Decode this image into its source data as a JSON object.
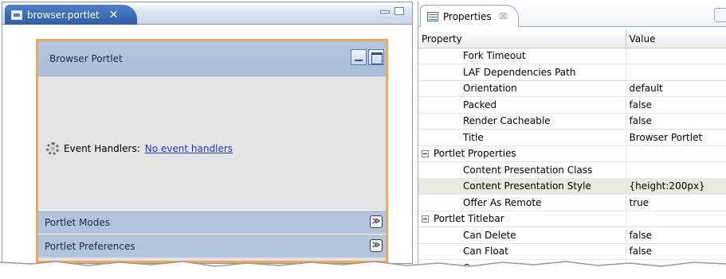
{
  "editor": {
    "tab_label": "browser.portlet",
    "close_glyph": "✕"
  },
  "portlet": {
    "title": "Browser Portlet",
    "event_handlers_label": "Event Handlers:",
    "event_handlers_link": "No event handlers",
    "sections": [
      {
        "label": "Portlet Modes"
      },
      {
        "label": "Portlet Preferences"
      }
    ],
    "toggle_glyph": "≫"
  },
  "properties": {
    "tab_label": "Properties",
    "close_glyph": "☒",
    "columns": [
      "Property",
      "Value"
    ],
    "rows": [
      {
        "property": "Fork Timeout",
        "value": "",
        "type": "child"
      },
      {
        "property": "LAF Dependencies Path",
        "value": "",
        "type": "child"
      },
      {
        "property": "Orientation",
        "value": "default",
        "type": "child"
      },
      {
        "property": "Packed",
        "value": "false",
        "type": "child"
      },
      {
        "property": "Render Cacheable",
        "value": "false",
        "type": "child"
      },
      {
        "property": "Title",
        "value": "Browser Portlet",
        "type": "child"
      },
      {
        "property": "Portlet Properties",
        "value": "",
        "type": "group"
      },
      {
        "property": "Content Presentation Class",
        "value": "",
        "type": "child"
      },
      {
        "property": "Content Presentation Style",
        "value": "{height:200px}",
        "type": "child",
        "selected": true
      },
      {
        "property": "Offer As Remote",
        "value": "true",
        "type": "child"
      },
      {
        "property": "Portlet Titlebar",
        "value": "",
        "type": "group"
      },
      {
        "property": "Can Delete",
        "value": "false",
        "type": "child"
      },
      {
        "property": "Can Float",
        "value": "false",
        "type": "child"
      },
      {
        "property": "Can Maximize",
        "value": "true",
        "type": "child"
      }
    ]
  },
  "icons": [
    "file-icon",
    "close-icon",
    "minimize-icon",
    "maximize-icon",
    "gear-icon",
    "expand-icon",
    "properties-icon",
    "collapse-icon"
  ],
  "colors": {
    "editor_tab": "#2d5ea7",
    "portlet_border": "#f2a65a",
    "portlet_titlebar": "#a9bcd9",
    "portlet_body": "#e3e3e3",
    "link": "#1a3cc9",
    "selected_row": "#ebe8e0"
  }
}
